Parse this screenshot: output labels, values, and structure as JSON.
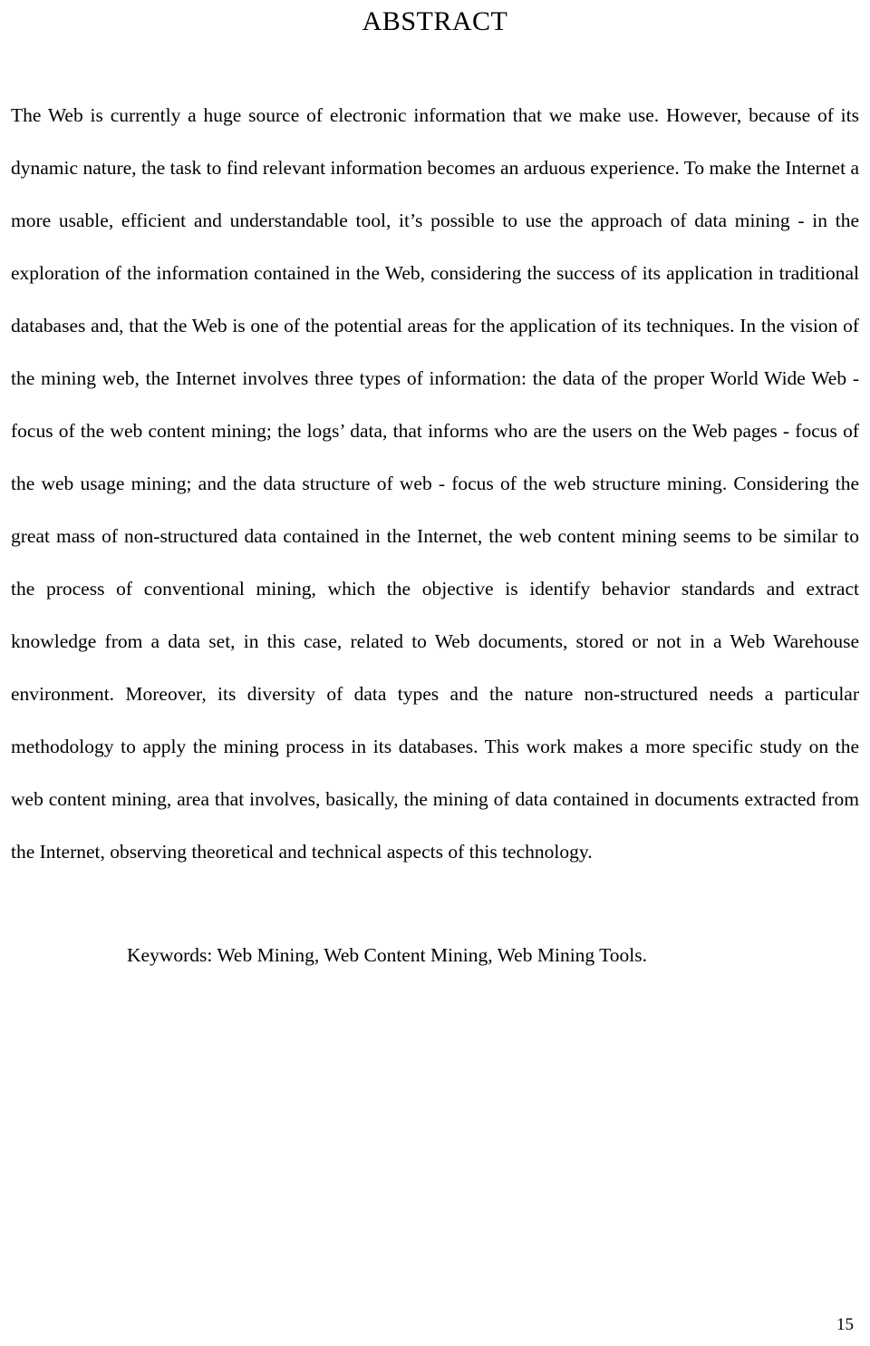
{
  "document": {
    "title": "ABSTRACT",
    "abstract_paragraph": "The Web is currently a huge source of electronic information that we make use. However, because of its dynamic nature, the task to find relevant information becomes an arduous experience. To make the Internet a more usable, efficient and understandable tool, it’s possible to use the approach of data mining - in the exploration of the information contained in the Web, considering the success of its application in traditional databases and, that the Web is one of the potential areas for the application of its techniques. In the vision of the mining web, the Internet involves three types of information: the data of the proper World Wide Web - focus of the web content mining; the logs’ data, that informs who are the users on the Web pages - focus of the web usage mining; and the data structure of web - focus of the web structure mining. Considering the great mass of non-structured data contained in the Internet, the web content mining seems to be similar to the process of conventional mining, which the objective is identify behavior standards and extract knowledge from a data set, in this case, related to Web documents, stored or not in a Web Warehouse environment. Moreover, its diversity of data types and the nature non-structured needs a particular methodology to apply the mining process in its databases. This work makes a more specific study on the web content mining, area that involves, basically, the mining of data contained in documents extracted from the Internet, observing theoretical and technical aspects of this technology.",
    "keywords_line": "Keywords: Web Mining, Web Content Mining, Web Mining Tools.",
    "page_number": "15"
  }
}
